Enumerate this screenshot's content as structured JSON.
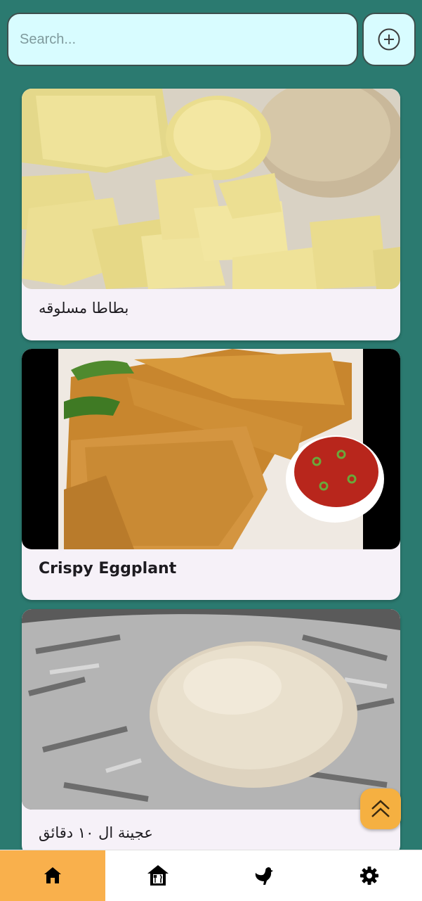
{
  "search": {
    "placeholder": "Search..."
  },
  "add_button": {
    "icon": "add-circle-icon"
  },
  "recipes": [
    {
      "title": "بطاطا مسلوقه",
      "image": "boiled-potatoes-photo"
    },
    {
      "title": "Crispy Eggplant",
      "image": "fried-eggplant-photo"
    },
    {
      "title": "عجينة ال ١٠ دقائق",
      "image": "dough-ball-photo"
    }
  ],
  "scroll_top": {
    "icon": "double-chevron-up-icon"
  },
  "bottom_nav": {
    "items": [
      {
        "name": "home",
        "icon": "home-icon",
        "active": true
      },
      {
        "name": "restaurant",
        "icon": "house-restaurant-icon",
        "active": false
      },
      {
        "name": "chicken",
        "icon": "chicken-icon",
        "active": false
      },
      {
        "name": "settings",
        "icon": "gear-icon",
        "active": false
      }
    ]
  },
  "colors": {
    "background": "#2b7a70",
    "search_bg": "#d8fcff",
    "card_bg": "#f6f1f8",
    "accent": "#f9b04c"
  }
}
